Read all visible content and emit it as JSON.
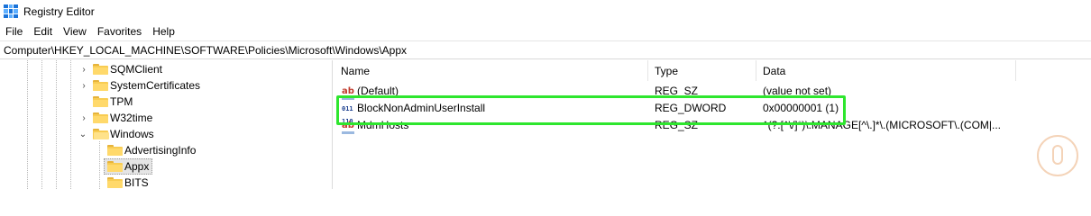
{
  "window": {
    "title": "Registry Editor"
  },
  "menu": {
    "items": [
      "File",
      "Edit",
      "View",
      "Favorites",
      "Help"
    ]
  },
  "address": {
    "path": "Computer\\HKEY_LOCAL_MACHINE\\SOFTWARE\\Policies\\Microsoft\\Windows\\Appx"
  },
  "tree": {
    "items": [
      {
        "label": "SQMClient",
        "expander": "collapsed"
      },
      {
        "label": "SystemCertificates",
        "expander": "collapsed"
      },
      {
        "label": "TPM",
        "expander": "none"
      },
      {
        "label": "W32time",
        "expander": "collapsed"
      },
      {
        "label": "Windows",
        "expander": "expanded"
      },
      {
        "label": "AdvertisingInfo",
        "expander": "none"
      },
      {
        "label": "Appx",
        "expander": "none",
        "selected": true
      },
      {
        "label": "BITS",
        "expander": "none"
      }
    ]
  },
  "list": {
    "columns": {
      "name": "Name",
      "type": "Type",
      "data": "Data"
    },
    "rows": [
      {
        "icon": "string-value-icon",
        "name": "(Default)",
        "type": "REG_SZ",
        "data": "(value not set)"
      },
      {
        "icon": "dword-value-icon",
        "name": "BlockNonAdminUserInstall",
        "type": "REG_DWORD",
        "data": "0x00000001 (1)"
      },
      {
        "icon": "string-value-icon",
        "name": "MdmHosts",
        "type": "REG_SZ",
        "data": "^(?:[^\\/]*)\\.MANAGE[^\\.]*\\.(MICROSOFT\\.(COM|..."
      }
    ]
  },
  "colors": {
    "highlight": "#2ee62e",
    "selection": "#e5e5e5",
    "folder": "#f8cc52"
  }
}
